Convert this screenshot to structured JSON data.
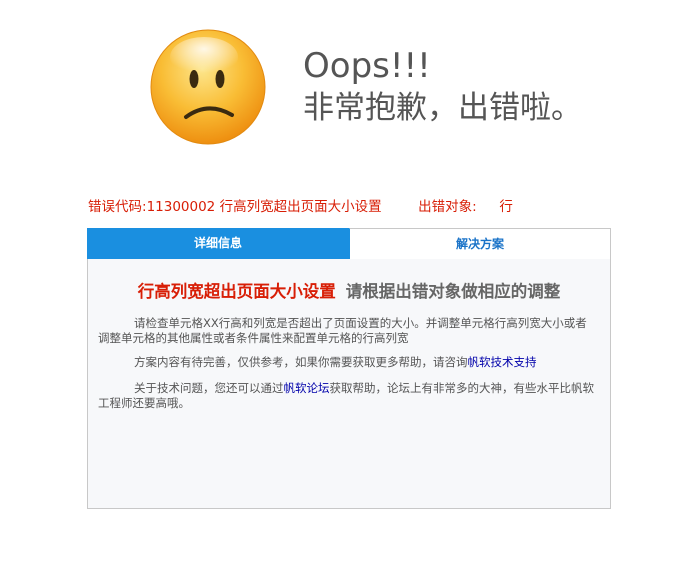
{
  "header": {
    "title": "Oops!!!",
    "apology": "非常抱歉，出错啦。"
  },
  "error": {
    "code_label": "错误代码:",
    "code": "11300002",
    "message": "行高列宽超出页面大小设置",
    "target_label": "出错对象:",
    "target": "行"
  },
  "tabs": [
    {
      "label": "详细信息",
      "active": true
    },
    {
      "label": "解决方案",
      "active": false
    }
  ],
  "content": {
    "heading_red": "行高列宽超出页面大小设置",
    "heading_gray": "请根据出错对象做相应的调整",
    "para1": "请检查单元格XX行高和列宽是否超出了页面设置的大小。并调整单元格行高列宽大小或者调整单元格的其他属性或者条件属性来配置单元格的行高列宽",
    "para2_text": "方案内容有待完善，仅供参考，如果你需要获取更多帮助，请咨询",
    "para2_link": "帆软技术支持",
    "para3_text_before": "关于技术问题，您还可以通过",
    "para3_link": "帆软论坛",
    "para3_text_after": "获取帮助，论坛上有非常多的大神，有些水平比帆软工程师还要高哦。"
  },
  "colors": {
    "error_red": "#d81e06",
    "tab_active_bg": "#1a8fe0",
    "link": "#0000aa",
    "face": "#f7a81b"
  },
  "icons": {
    "face": "sad-face-icon"
  }
}
